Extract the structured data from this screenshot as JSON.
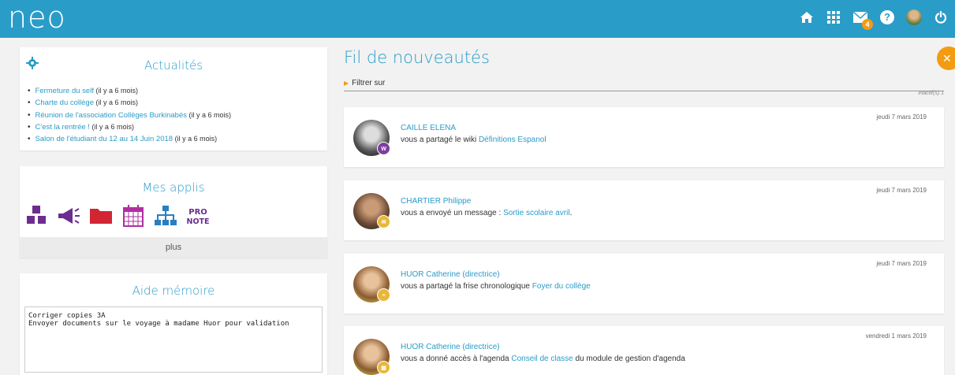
{
  "header": {
    "logo": "neo",
    "mail_badge": "4",
    "icons": [
      "home-icon",
      "apps-grid-icon",
      "mail-icon",
      "help-icon",
      "user-avatar",
      "power-icon"
    ]
  },
  "news": {
    "title": "Actualités",
    "items": [
      {
        "label": "Fermeture du self",
        "age": "(il y a 6 mois)"
      },
      {
        "label": "Charte du collège",
        "age": "(il y a 6 mois)"
      },
      {
        "label": "Réunion de l'association Collèges Burkinabés",
        "age": "(il y a 6 mois)"
      },
      {
        "label": "C'est la rentrée !",
        "age": "(il y a 6 mois)"
      },
      {
        "label": "Salon de l'étudiant du 12 au 14 Juin 2018",
        "age": "(il y a 6 mois)"
      }
    ]
  },
  "apps": {
    "title": "Mes applis",
    "items": [
      "blocks-icon",
      "megaphone-icon",
      "folder-icon",
      "calendar-icon",
      "sitemap-icon",
      "pronote-icon"
    ],
    "pronote_label_1": "PRO",
    "pronote_label_2": "NOTE",
    "more_label": "plus"
  },
  "memo": {
    "title": "Aide mémoire",
    "text": "Corriger copies 3A\nEnvoyer documents sur le voyage à madame Huor pour validation"
  },
  "feed": {
    "title": "Fil de nouveautés",
    "filter_label": "Filtrer sur",
    "inactive_label": "Inactif(s) 1",
    "cards": [
      {
        "date": "jeudi 7 mars 2019",
        "author": "CAILLE ELENA",
        "action": "vous a partagé le wiki ",
        "link": "Définitions Espanol",
        "suffix": "",
        "badge": "W",
        "badge_color": "#7b3fa0",
        "avatar": "#888"
      },
      {
        "date": "jeudi 7 mars 2019",
        "author": "CHARTIER Philippe",
        "action": "vous a envoyé un message : ",
        "link": "Sortie scolaire avril",
        "suffix": ".",
        "badge": "✉",
        "badge_color": "#e8b73a",
        "avatar": "#8a5a3c"
      },
      {
        "date": "jeudi 7 mars 2019",
        "author": "HUOR Catherine (directrice)",
        "action": "vous a partagé la frise chronologique ",
        "link": "Foyer du collège",
        "suffix": "",
        "badge": "≡",
        "badge_color": "#e8b73a",
        "avatar": "#b98a5e"
      },
      {
        "date": "vendredi 1 mars 2019",
        "author": "HUOR Catherine (directrice)",
        "action": "vous a donné accès à l'agenda ",
        "link": "Conseil de classe ",
        "suffix": " du module de gestion d'agenda",
        "badge": "▦",
        "badge_color": "#e8b73a",
        "avatar": "#b98a5e"
      }
    ]
  }
}
